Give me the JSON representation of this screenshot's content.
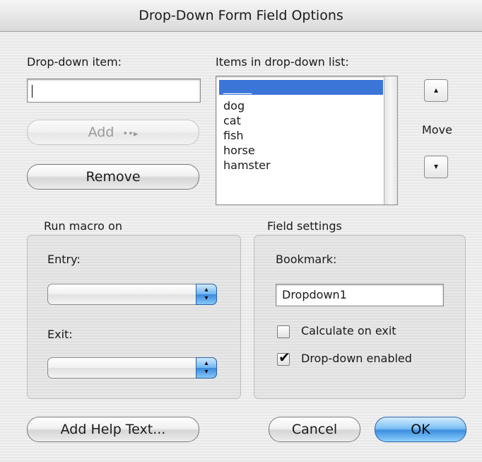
{
  "window": {
    "title": "Drop-Down Form Field Options"
  },
  "dropdown_item": {
    "label": "Drop-down item:",
    "value": ""
  },
  "buttons": {
    "add": "Add",
    "add_icon": "••▸",
    "remove": "Remove",
    "add_help": "Add Help Text...",
    "cancel": "Cancel",
    "ok": "OK"
  },
  "list": {
    "label": "Items in drop-down list:",
    "items": [
      "_____",
      "dog",
      "cat",
      "fish",
      "horse",
      "hamster"
    ],
    "selected_index": 0
  },
  "move": {
    "label": "Move",
    "up_icon": "▴",
    "down_icon": "▾"
  },
  "macro": {
    "group_label": "Run macro on",
    "entry_label": "Entry:",
    "entry_value": "",
    "exit_label": "Exit:",
    "exit_value": ""
  },
  "field_settings": {
    "group_label": "Field settings",
    "bookmark_label": "Bookmark:",
    "bookmark_value": "Dropdown1",
    "calculate_label": "Calculate on exit",
    "calculate_checked": false,
    "enabled_label": "Drop-down enabled",
    "enabled_checked": true
  },
  "colors": {
    "selection": "#3b75d8",
    "default_button": "#5aa6ec"
  },
  "icons": {
    "checkmark": "✔",
    "popup_arrows": "▴▾"
  }
}
